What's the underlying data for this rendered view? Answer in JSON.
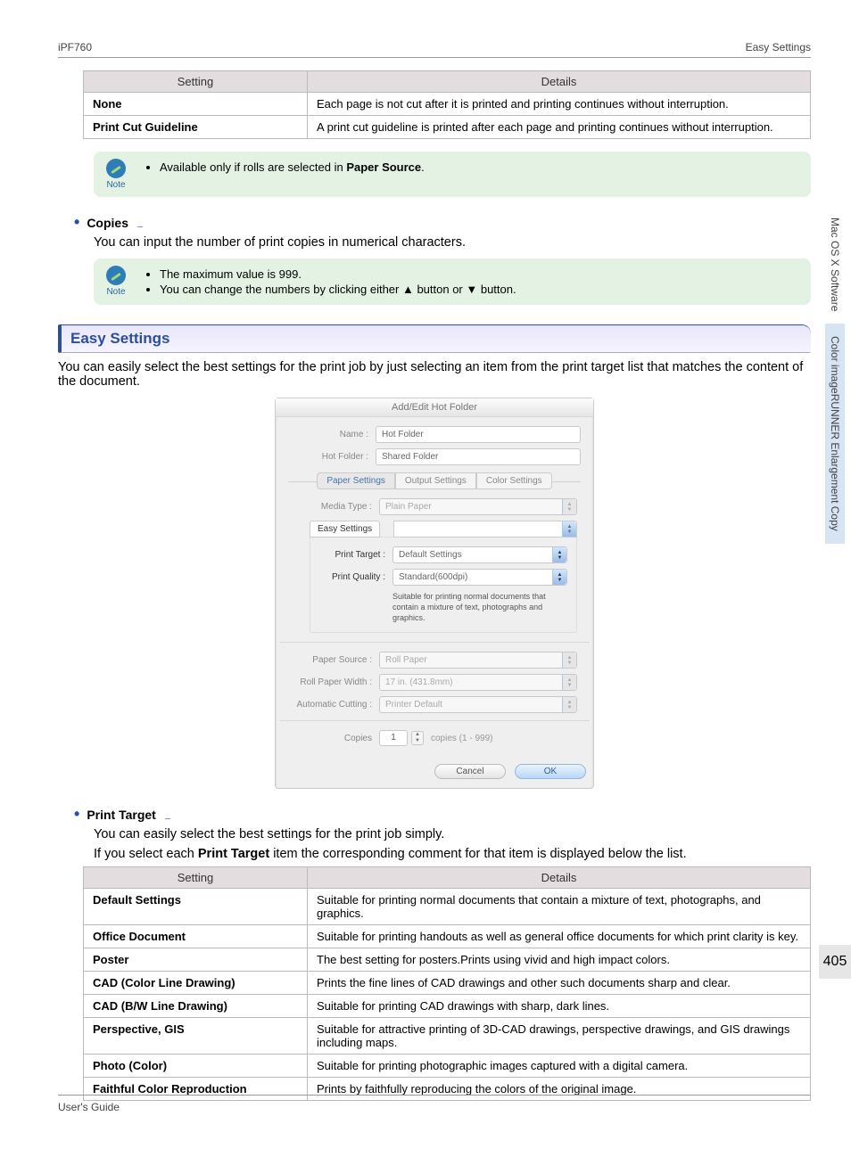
{
  "header": {
    "left": "iPF760",
    "right": "Easy Settings"
  },
  "footer": {
    "left": "User's Guide"
  },
  "sidebar": {
    "topic1": "Mac OS X Software",
    "topic2": "Color imageRUNNER Enlargement Copy",
    "page": "405"
  },
  "table1": {
    "head": {
      "c1": "Setting",
      "c2": "Details"
    },
    "rows": [
      {
        "name": "None",
        "detail": "Each page is not cut after it is printed and printing continues without interruption."
      },
      {
        "name": "Print Cut Guideline",
        "detail": "A print cut guideline is printed after each page and printing continues without interruption."
      }
    ]
  },
  "note1": {
    "label": "Note",
    "items": [
      {
        "pre": "Available only if rolls are selected in ",
        "bold": "Paper Source",
        "post": "."
      }
    ]
  },
  "copies": {
    "heading": "Copies",
    "body": "You can input the number of print copies in numerical characters."
  },
  "note2": {
    "label": "Note",
    "items": [
      {
        "text": "The maximum value is 999."
      },
      {
        "text": "You can change the numbers by clicking either ▲ button or ▼ button."
      }
    ]
  },
  "section": {
    "title": "Easy Settings",
    "body": "You can easily select the best settings for the print job by just selecting an item from the print target list that matches the content of the document."
  },
  "dialog": {
    "title": "Add/Edit Hot Folder",
    "name_lbl": "Name :",
    "name_val": "Hot Folder",
    "hotfolder_lbl": "Hot Folder :",
    "hotfolder_val": "Shared Folder",
    "tabs": {
      "t1": "Paper Settings",
      "t2": "Output Settings",
      "t3": "Color Settings"
    },
    "media_lbl": "Media Type :",
    "media_val": "Plain Paper",
    "subtab": "Easy Settings",
    "ptarget_lbl": "Print Target :",
    "ptarget_val": "Default Settings",
    "pquality_lbl": "Print Quality :",
    "pquality_val": "Standard(600dpi)",
    "desc": "Suitable for printing normal documents that contain a mixture of text, photographs and graphics.",
    "psource_lbl": "Paper Source :",
    "psource_val": "Roll Paper",
    "rwidth_lbl": "Roll Paper Width :",
    "rwidth_val": "17 in. (431.8mm)",
    "autocut_lbl": "Automatic Cutting :",
    "autocut_val": "Printer Default",
    "copies_lbl": "Copies",
    "copies_val": "1",
    "copies_hint": "copies (1 - 999)",
    "cancel": "Cancel",
    "ok": "OK"
  },
  "ptarget": {
    "heading": "Print Target",
    "body1": "You can easily select the best settings for the print job simply.",
    "body2_pre": "If you select each ",
    "body2_bold": "Print Target",
    "body2_post": " item the corresponding comment for that item is displayed below the list."
  },
  "table2": {
    "head": {
      "c1": "Setting",
      "c2": "Details"
    },
    "rows": [
      {
        "name": "Default Settings",
        "detail": "Suitable for printing normal documents that contain a mixture of text, photographs, and graphics."
      },
      {
        "name": "Office Document",
        "detail": "Suitable for printing handouts as well as general office documents for which print clarity is key."
      },
      {
        "name": "Poster",
        "detail": "The best setting for posters.Prints using vivid and high impact colors."
      },
      {
        "name": "CAD (Color Line Drawing)",
        "detail": "Prints the fine lines of CAD drawings and other such documents sharp and clear."
      },
      {
        "name": "CAD (B/W Line Drawing)",
        "detail": "Suitable for printing CAD drawings with sharp, dark lines."
      },
      {
        "name": "Perspective, GIS",
        "detail": "Suitable for attractive printing of 3D-CAD drawings, perspective drawings, and GIS drawings including maps."
      },
      {
        "name": "Photo (Color)",
        "detail": "Suitable for printing photographic images captured with a digital camera."
      },
      {
        "name": "Faithful Color Reproduction",
        "detail": "Prints by faithfully reproducing the colors of the original image."
      }
    ]
  }
}
